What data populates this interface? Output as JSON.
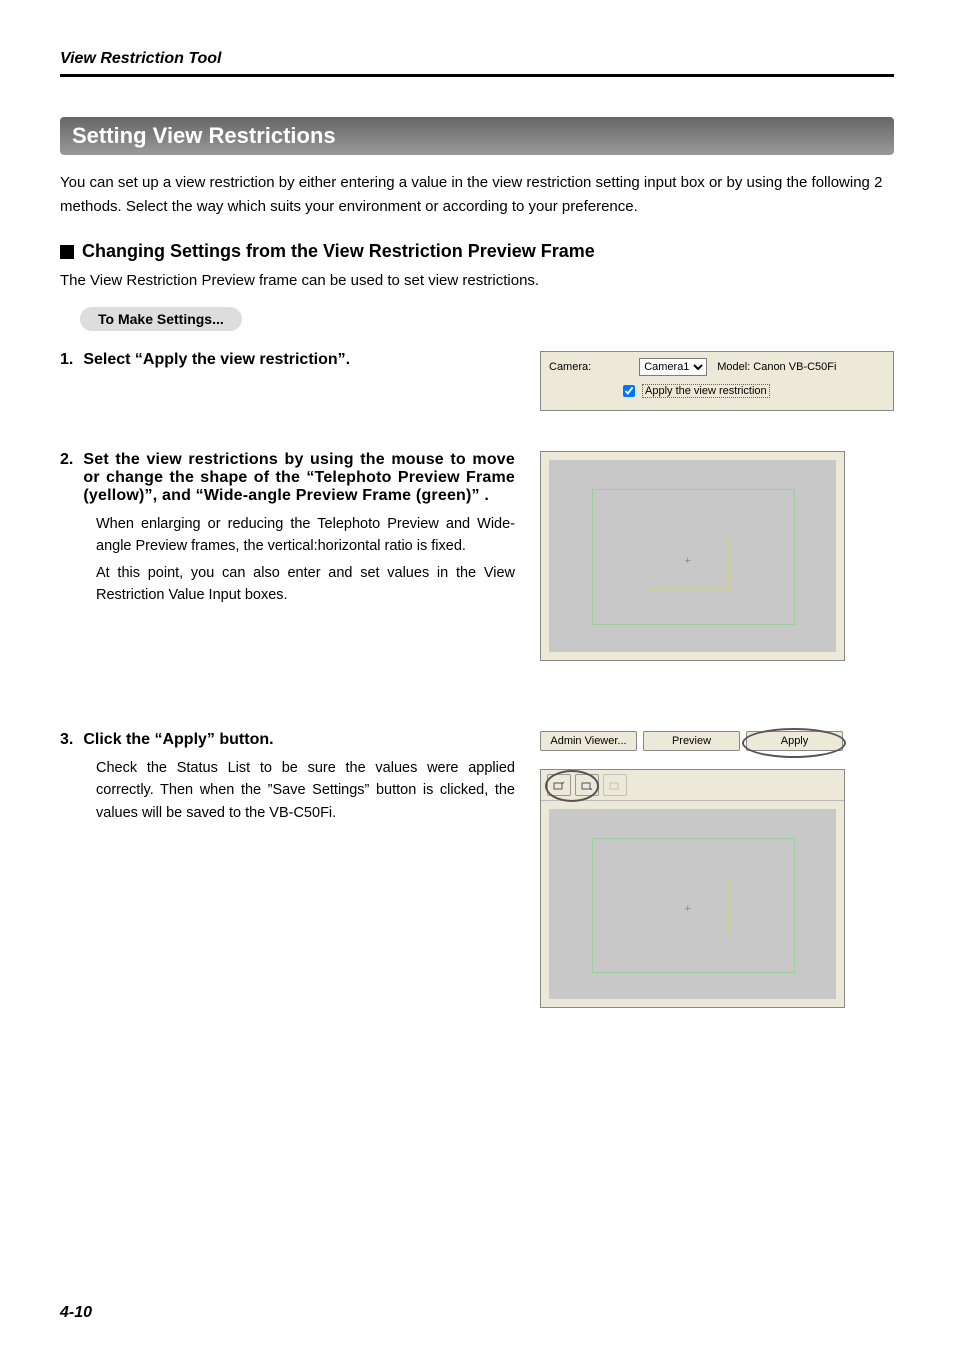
{
  "header": {
    "title": "View Restriction Tool"
  },
  "section": {
    "title": "Setting View Restrictions"
  },
  "intro": "You can set up a view restriction by either entering a value in the view restriction setting input box or by using the following 2 methods. Select the way which suits your environment or according to your preference.",
  "sub": {
    "title": "Changing Settings from the View Restriction Preview Frame",
    "desc": "The View Restriction Preview frame can be used to set view restrictions.",
    "pill": "To Make Settings..."
  },
  "step1": {
    "num": "1.",
    "title": "Select “Apply the view restriction”.",
    "camera_label": "Camera:",
    "camera_value": "Camera1",
    "model_label": "Model: Canon VB-C50Fi",
    "checkbox_label": "Apply the view restriction"
  },
  "step2": {
    "num": "2.",
    "title": "Set the view restrictions by using the mouse to move or change the shape of the “Telephoto Preview Frame (yellow)”, and “Wide-angle Preview Frame (green)” .",
    "body1": "When enlarging or reducing the Telephoto Preview and Wide-angle Preview frames, the vertical:horizontal ratio is fixed.",
    "body2": "At this point, you can also enter and set values in the View Restriction Value Input boxes.",
    "plus": "+"
  },
  "step3": {
    "num": "3.",
    "title": "Click the “Apply” button.",
    "body": "Check the Status List to be sure the values were applied correctly. Then when the ”Save Settings” button is clicked, the values will be saved to the VB-C50Fi.",
    "btn_admin": "Admin Viewer...",
    "btn_preview": "Preview",
    "btn_apply": "Apply",
    "plus": "+"
  },
  "footer": {
    "page": "4-10"
  }
}
